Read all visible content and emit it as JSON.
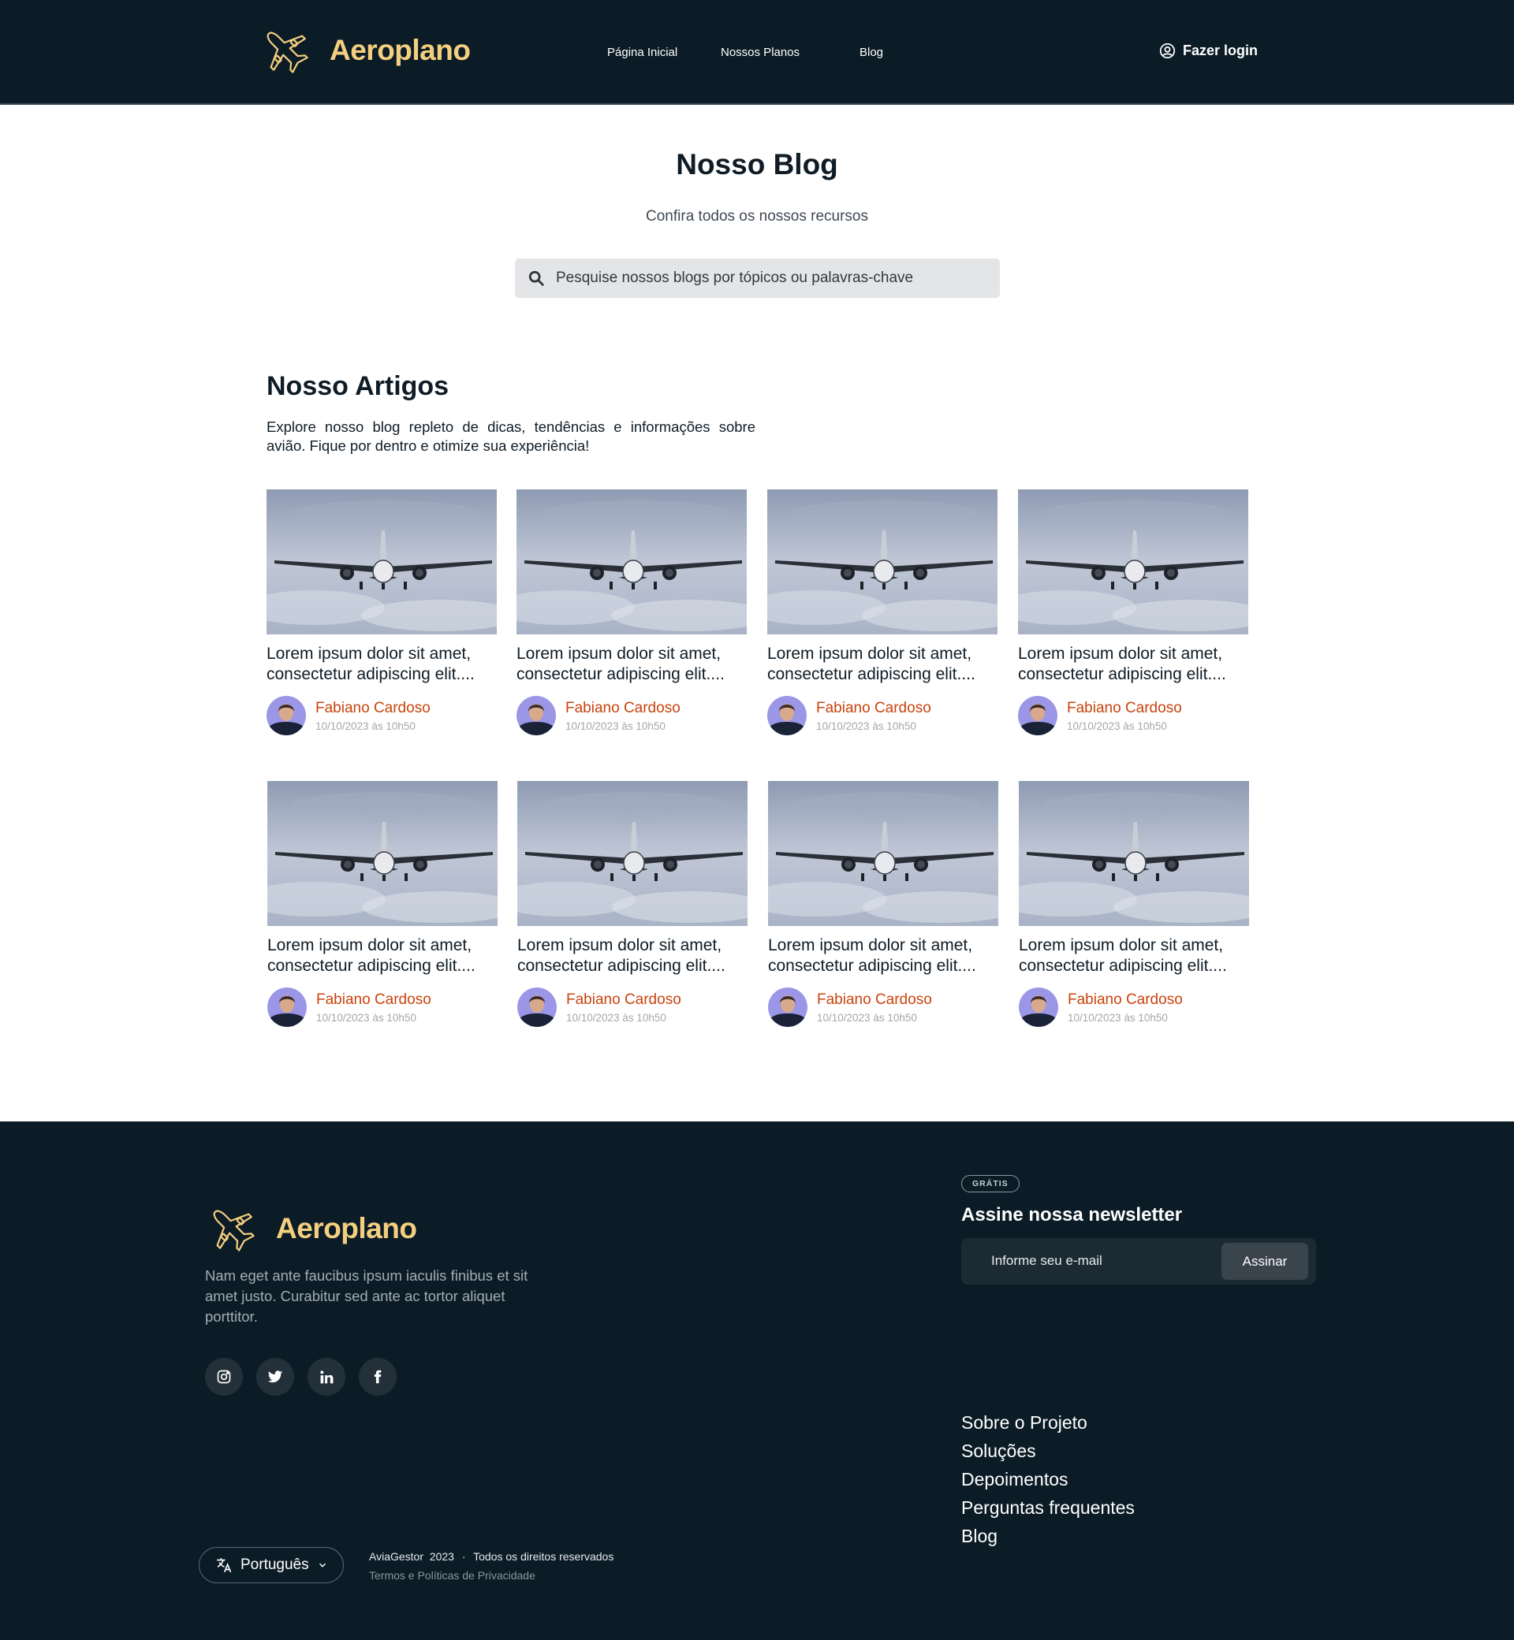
{
  "brand": {
    "name": "Aeroplano",
    "logo_color": "#f4cf7f"
  },
  "nav": {
    "items": [
      "Página Inicial",
      "Nossos Planos",
      "Blog"
    ],
    "login_label": "Fazer login"
  },
  "hero": {
    "title": "Nosso Blog",
    "subtitle": "Confira todos os nossos recursos",
    "search_placeholder": "Pesquise nossos blogs por tópicos ou palavras-chave"
  },
  "articles": {
    "title": "Nosso Artigos",
    "description": "Explore nosso blog repleto de dicas, tendências e informações sobre avião. Fique por dentro e otimize sua experiência!",
    "cards": [
      {
        "title": "Lorem ipsum dolor sit amet, consectetur adipiscing elit....",
        "author": "Fabiano Cardoso",
        "date": "10/10/2023 às 10h50"
      },
      {
        "title": "Lorem ipsum dolor sit amet, consectetur adipiscing elit....",
        "author": "Fabiano Cardoso",
        "date": "10/10/2023 às 10h50"
      },
      {
        "title": "Lorem ipsum dolor sit amet, consectetur adipiscing elit....",
        "author": "Fabiano Cardoso",
        "date": "10/10/2023 às 10h50"
      },
      {
        "title": "Lorem ipsum dolor sit amet, consectetur adipiscing elit....",
        "author": "Fabiano Cardoso",
        "date": "10/10/2023 às 10h50"
      },
      {
        "title": "Lorem ipsum dolor sit amet, consectetur adipiscing elit....",
        "author": "Fabiano Cardoso",
        "date": "10/10/2023 às 10h50"
      },
      {
        "title": "Lorem ipsum dolor sit amet, consectetur adipiscing elit....",
        "author": "Fabiano Cardoso",
        "date": "10/10/2023 às 10h50"
      },
      {
        "title": "Lorem ipsum dolor sit amet, consectetur adipiscing elit....",
        "author": "Fabiano Cardoso",
        "date": "10/10/2023 às 10h50"
      },
      {
        "title": "Lorem ipsum dolor sit amet, consectetur adipiscing elit....",
        "author": "Fabiano Cardoso",
        "date": "10/10/2023 às 10h50"
      }
    ]
  },
  "footer": {
    "description": "Nam eget ante faucibus ipsum iaculis finibus et sit amet justo. Curabitur sed ante ac tortor aliquet porttitor.",
    "socials": [
      "instagram-icon",
      "twitter-icon",
      "linkedin-icon",
      "facebook-icon"
    ],
    "newsletter": {
      "badge": "GRÁTIS",
      "title": "Assine nossa newsletter",
      "placeholder": "Informe seu e-mail",
      "button": "Assinar"
    },
    "links": [
      "Sobre o Projeto",
      "Soluções",
      "Depoimentos",
      "Perguntas frequentes",
      "Blog"
    ],
    "language": "Português",
    "copyright": {
      "company": "AviaGestor",
      "year": "2023",
      "rights": "Todos os direitos reservados"
    },
    "policy": "Termos e Políticas de Privacidade"
  },
  "colors": {
    "dark_bg": "#0c1c27",
    "accent_orange": "#c9430c",
    "accent_gold": "#f4cf7f"
  }
}
